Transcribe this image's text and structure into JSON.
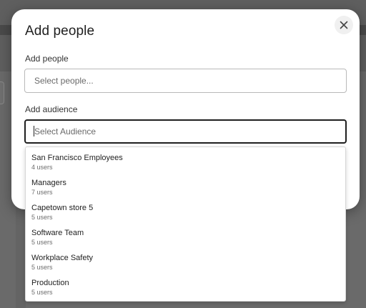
{
  "modal": {
    "title": "Add people",
    "close_icon": "close-icon"
  },
  "people_field": {
    "label": "Add people",
    "placeholder": "Select people...",
    "value": ""
  },
  "audience_field": {
    "label": "Add audience",
    "placeholder": "Select Audience",
    "value": ""
  },
  "audience_options": [
    {
      "name": "San Francisco Employees",
      "count": "4 users"
    },
    {
      "name": "Managers",
      "count": "7 users"
    },
    {
      "name": "Capetown store 5",
      "count": "5 users"
    },
    {
      "name": "Software Team",
      "count": "5 users"
    },
    {
      "name": "Workplace Safety",
      "count": "5 users"
    },
    {
      "name": "Production",
      "count": "5 users"
    }
  ]
}
